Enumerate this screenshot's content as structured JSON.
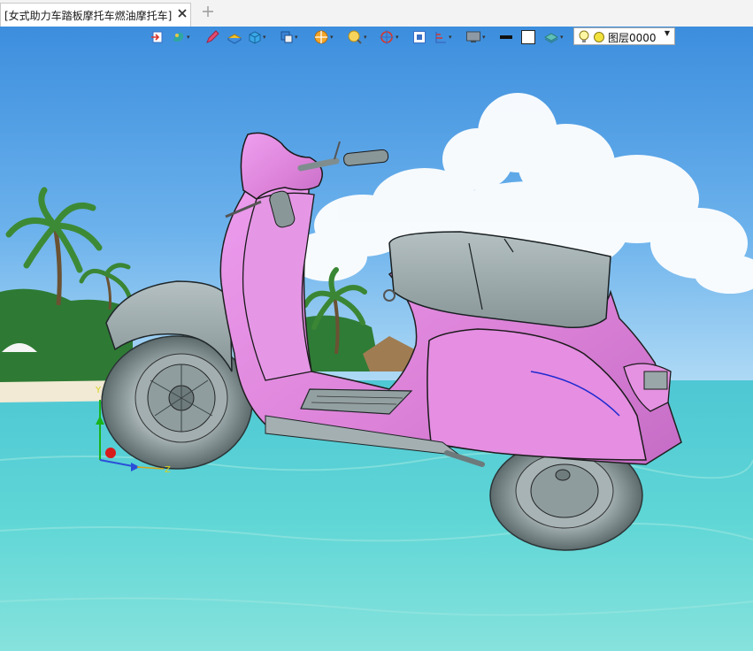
{
  "tab": {
    "title": "[女式助力车踏板摩托车燃油摩托车]"
  },
  "toolbar": {
    "items": [
      {
        "name": "import-icon"
      },
      {
        "name": "render-mode-icon",
        "dropdown": true
      },
      {
        "name": "pen-icon"
      },
      {
        "name": "material-icon"
      },
      {
        "name": "solid-icon",
        "dropdown": true
      },
      {
        "name": "view-icon",
        "dropdown": true
      },
      {
        "name": "section-icon",
        "dropdown": true
      },
      {
        "name": "zoom-icon",
        "dropdown": true
      },
      {
        "name": "orient-icon",
        "dropdown": true
      },
      {
        "name": "fit-icon"
      },
      {
        "name": "measure-icon",
        "dropdown": true
      },
      {
        "name": "display-icon",
        "dropdown": true
      },
      {
        "name": "color-swatch-black"
      },
      {
        "name": "color-swatch-white"
      },
      {
        "name": "layer-manager-icon",
        "dropdown": true
      }
    ],
    "layer": {
      "value": "图层0000"
    }
  },
  "colors": {
    "body": "#e48fe0",
    "gray_parts": "#9aa8aa",
    "sky": "#5ea4e2",
    "sea": "#59d2d2",
    "axis_x": "#2a4ed8",
    "axis_y": "#19b31b",
    "axis_z": "#d81b1b"
  }
}
